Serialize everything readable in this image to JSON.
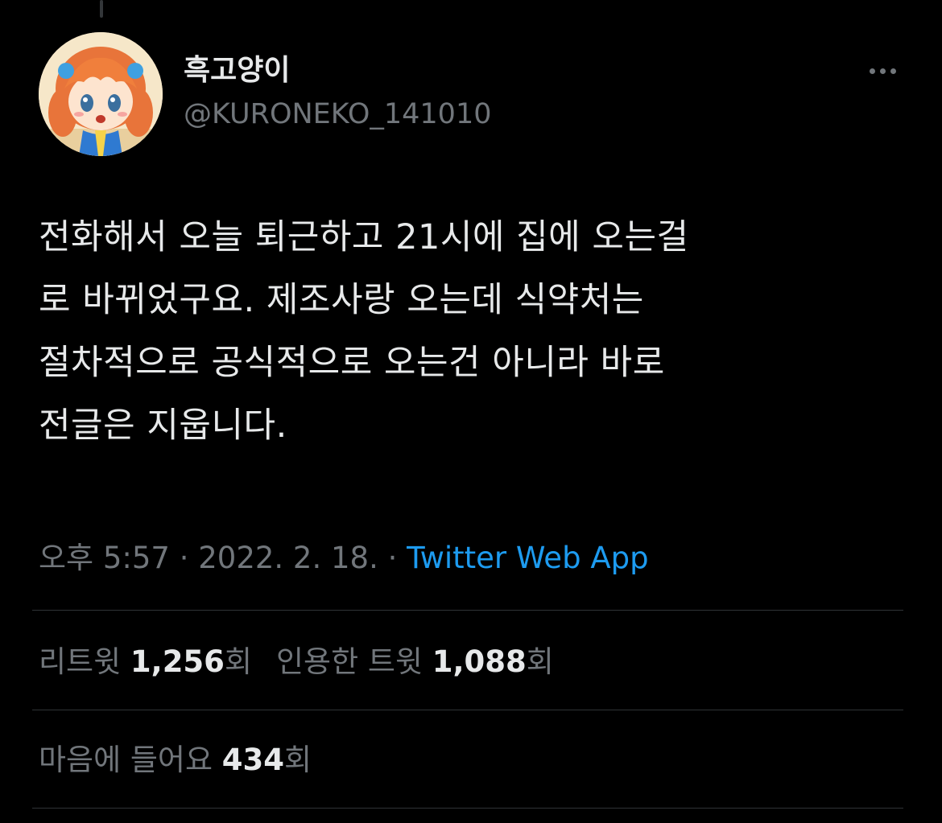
{
  "author": {
    "display_name": "흑고양이",
    "handle": "@KURONEKO_141010",
    "avatar_icon": "anime-girl-avatar"
  },
  "more_icon": "more-horizontal-icon",
  "tweet": {
    "text": "전화해서 오늘 퇴근하고 21시에 집에 오는걸\n로 바뀌었구요. 제조사랑 오는데 식약처는\n절차적으로 공식적으로 오는건 아니라 바로\n전글은 지웁니다."
  },
  "meta": {
    "time": "오후 5:57",
    "separator": " · ",
    "date": "2022. 2. 18.",
    "source": "Twitter Web App"
  },
  "stats": {
    "retweets_label": "리트윗",
    "retweets_count": "1,256",
    "retweets_unit": "회",
    "quotes_label": "인용한 트윗",
    "quotes_count": "1,088",
    "quotes_unit": "회",
    "likes_label": "마음에 들어요",
    "likes_count": "434",
    "likes_unit": "회"
  },
  "colors": {
    "background": "#000000",
    "text": "#e7e9ea",
    "secondary": "#71767b",
    "link": "#1d9bf0",
    "divider": "#2f3336"
  }
}
